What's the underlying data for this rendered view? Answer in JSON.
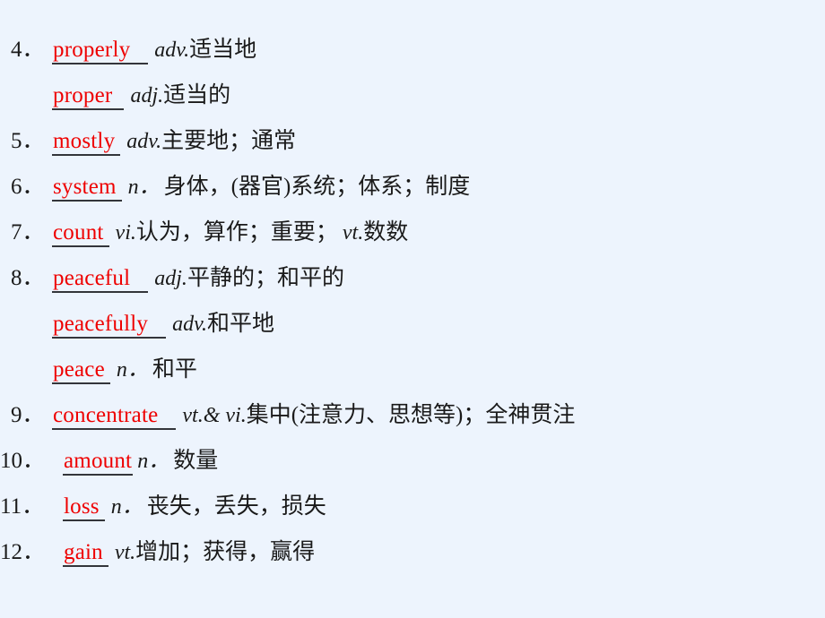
{
  "slide": {
    "background_color": "#edf4fd",
    "word_color": "#ee0000",
    "text_color": "#1a1a1a",
    "underline_color": "#33353a"
  },
  "entries": [
    {
      "number": "4．",
      "word": "properly",
      "pos": "adv.",
      "gloss": "适当地"
    },
    {
      "number": "",
      "word": "proper",
      "pos": "adj.",
      "gloss": "适当的"
    },
    {
      "number": "5．",
      "word": "mostly",
      "pos": "adv.",
      "gloss": "主要地；通常"
    },
    {
      "number": "6．",
      "word": "system",
      "pos": "n．",
      "gloss": "身体，(器官)系统；体系；制度"
    },
    {
      "number": "7．",
      "word": "count",
      "pos": "vi.",
      "gloss": "认为，算作；重要；",
      "pos2": "vt.",
      "gloss2": "数数"
    },
    {
      "number": "8．",
      "word": "peaceful",
      "pos": "adj.",
      "gloss": "平静的；和平的"
    },
    {
      "number": "",
      "word": "peacefully",
      "pos": "adv.",
      "gloss": "和平地"
    },
    {
      "number": "",
      "word": "peace",
      "pos": "n．",
      "gloss": "和平"
    },
    {
      "number": "9．",
      "word": "concentrate",
      "pos": "vt.& vi.",
      "gloss": "集中(注意力、思想等)；全神贯注"
    },
    {
      "number": "10．",
      "word": "amount",
      "pos": "n．",
      "gloss": "数量"
    },
    {
      "number": "11．",
      "word": "loss",
      "pos": "n．",
      "gloss": "丧失，丢失，损失"
    },
    {
      "number": "12．",
      "word": "gain",
      "pos": "vt.",
      "gloss": "增加；获得，赢得"
    }
  ]
}
